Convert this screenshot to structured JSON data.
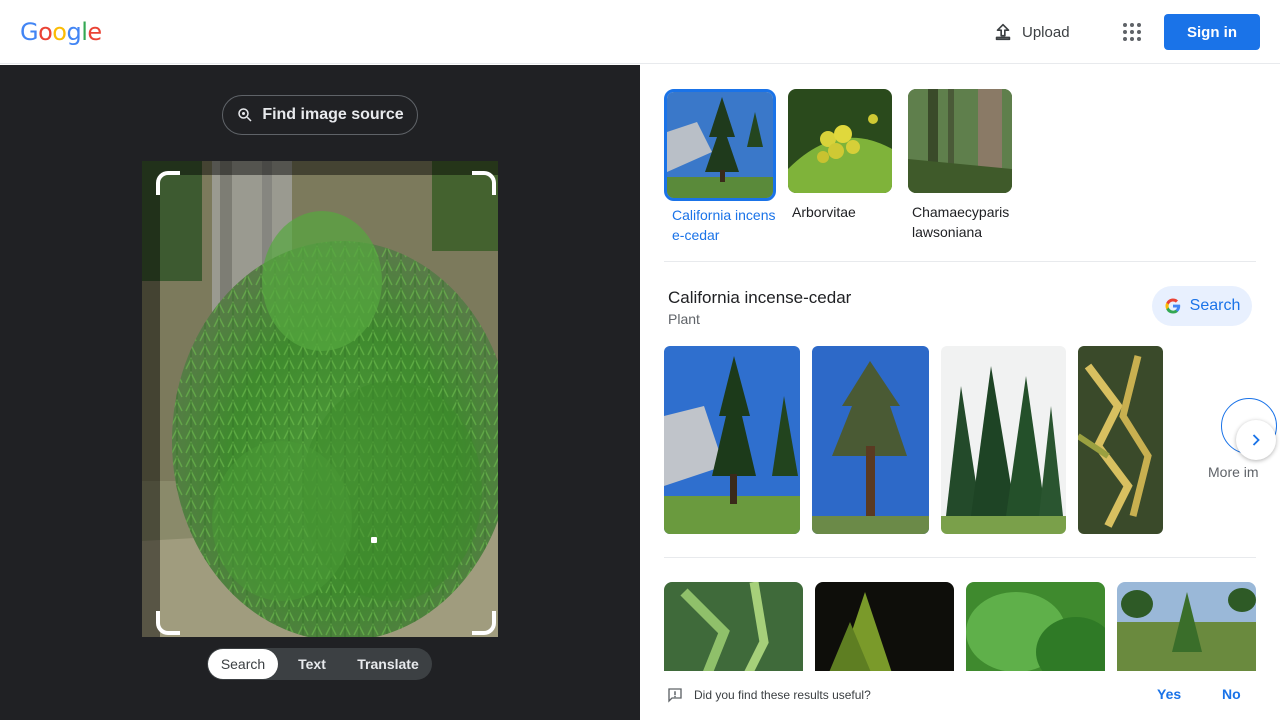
{
  "header": {
    "logo_letters": [
      "G",
      "o",
      "o",
      "g",
      "l",
      "e"
    ],
    "logo_colors": [
      "#4285f4",
      "#ea4335",
      "#fbbc05",
      "#4285f4",
      "#34a853",
      "#ea4335"
    ],
    "upload_label": "Upload",
    "signin_label": "Sign in"
  },
  "lens": {
    "find_source_label": "Find image source",
    "modes": [
      "Search",
      "Text",
      "Translate"
    ],
    "active_mode": "Search"
  },
  "suggestions": [
    {
      "label": "California incense-cedar",
      "active": true
    },
    {
      "label": "Arborvitae",
      "active": false
    },
    {
      "label": "Chamaecyparis lawsoniana",
      "active": false
    }
  ],
  "entity": {
    "title": "California incense-cedar",
    "subtitle": "Plant",
    "search_label": "Search",
    "more_label": "More im"
  },
  "feedback": {
    "question": "Did you find these results useful?",
    "yes_label": "Yes",
    "no_label": "No"
  },
  "colors": {
    "accent": "#1a73e8",
    "dark_panel": "#202124"
  }
}
